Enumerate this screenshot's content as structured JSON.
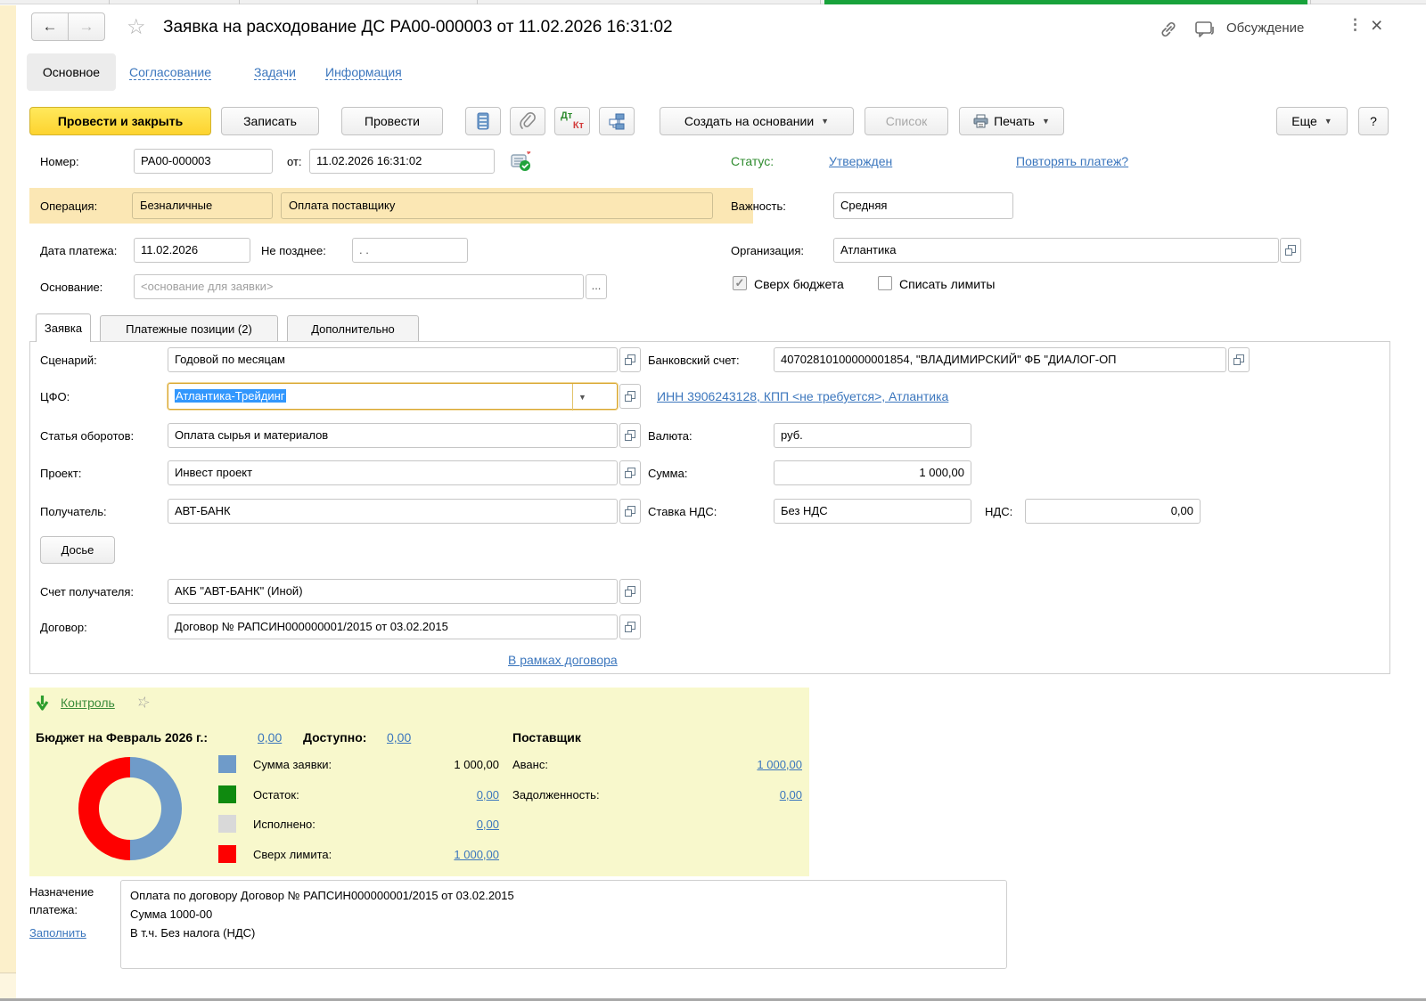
{
  "window": {
    "title": "Заявка на расходование ДС РА00-000003 от 11.02.2026 16:31:02",
    "discussion_label": "Обсуждение",
    "close_glyph": "×",
    "kebab_glyph": "⋮",
    "back_glyph": "←",
    "forward_glyph": "→",
    "star_glyph": "☆"
  },
  "nav": {
    "items": [
      {
        "label": "Основное"
      },
      {
        "label": "Согласование"
      },
      {
        "label": "Задачи"
      },
      {
        "label": "Информация"
      }
    ]
  },
  "toolbar": {
    "post_and_close": "Провести и закрыть",
    "write": "Записать",
    "post": "Провести",
    "dt": "Дт",
    "kt": "Кт",
    "create_on_base": "Создать на основании",
    "list": "Список",
    "print": "Печать",
    "more": "Еще",
    "help": "?"
  },
  "doc": {
    "number_label": "Номер:",
    "number": "РА00-000003",
    "from_label": "от:",
    "datetime": "11.02.2026 16:31:02",
    "status_label": "Статус:",
    "status_value": "Утвержден",
    "repeat_link": "Повторять платеж?"
  },
  "operation": {
    "label": "Операция:",
    "cash_type": "Безналичные",
    "op_kind": "Оплата поставщику",
    "importance_label": "Важность:",
    "importance_value": "Средняя"
  },
  "requisites": {
    "pay_date_label": "Дата платежа:",
    "pay_date": "11.02.2026",
    "not_later_label": "Не позднее:",
    "not_later": ".  .",
    "basis_label": "Основание:",
    "basis_placeholder": "<основание для заявки>",
    "dots": "...",
    "org_label": "Организация:",
    "org_value": "Атлантика",
    "over_budget_label": "Сверх бюджета",
    "check_glyph": "✓",
    "write_limits_label": "Списать лимиты"
  },
  "tabs": {
    "items": [
      {
        "label": "Заявка"
      },
      {
        "label": "Платежные позиции (2)"
      },
      {
        "label": "Дополнительно"
      }
    ]
  },
  "request": {
    "scenario_label": "Сценарий:",
    "scenario": "Годовой по месяцам",
    "cfo_label": "ЦФО:",
    "cfo": "Атлантика-Трейдинг",
    "turnover_label": "Статья оборотов:",
    "turnover": "Оплата сырья и материалов",
    "project_label": "Проект:",
    "project": "Инвест проект",
    "payee_label": "Получатель:",
    "payee": "АВТ-БАНК",
    "dossier": "Досье",
    "payee_account_label": "Счет получателя:",
    "payee_account": "АКБ \"АВТ-БАНК\" (Иной)",
    "contract_label": "Договор:",
    "contract": "Договор № РАПСИН000000001/2015 от 03.02.2015",
    "in_contract_link": "В рамках договора",
    "bank_account_label": "Банковский счет:",
    "bank_account": "40702810100000001854, \"ВЛАДИМИРСКИЙ\" ФБ \"ДИАЛОГ-ОП",
    "inn_link": "ИНН 3906243128, КПП <не требуется>, Атлантика",
    "currency_label": "Валюта:",
    "currency": "руб.",
    "amount_label": "Сумма:",
    "amount": "1 000,00",
    "vat_rate_label": "Ставка НДС:",
    "vat_rate": "Без НДС",
    "vat_label": "НДС:",
    "vat": "0,00"
  },
  "control": {
    "title": "Контроль",
    "budget_label": "Бюджет на Февраль 2026 г.:",
    "budget_value": "0,00",
    "available_label": "Доступно:",
    "available_value": "0,00",
    "supplier_title": "Поставщик",
    "legend": [
      {
        "label": "Сумма заявки:",
        "value": "1 000,00",
        "color": "#6f9bc9"
      },
      {
        "label": "Остаток:",
        "value": "0,00",
        "color": "#0f8a0f"
      },
      {
        "label": "Исполнено:",
        "value": "0,00",
        "color": "#d9d9d9"
      },
      {
        "label": "Сверх лимита:",
        "value": "1 000,00",
        "color": "#fe0000"
      }
    ],
    "advance_label": "Аванс:",
    "advance_value": "1 000,00",
    "debt_label": "Задолженность:",
    "debt_value": "0,00"
  },
  "chart_data": {
    "type": "pie",
    "donut": true,
    "title": "Контроль бюджета на Февраль 2026 г.",
    "slices": [
      {
        "label": "Сумма заявки",
        "value": 1000.0,
        "color": "#6f9bc9"
      },
      {
        "label": "Остаток",
        "value": 0.0,
        "color": "#0f8a0f"
      },
      {
        "label": "Исполнено",
        "value": 0.0,
        "color": "#d9d9d9"
      },
      {
        "label": "Сверх лимита",
        "value": 1000.0,
        "color": "#fe0000"
      }
    ],
    "legend_position": "right"
  },
  "purpose": {
    "label": "Назначение платежа:",
    "fill_link": "Заполнить",
    "text": "Оплата по договору Договор № РАПСИН000000001/2015 от 03.02.2015\nСумма 1000-00\nВ т.ч. Без налога (НДС)"
  }
}
